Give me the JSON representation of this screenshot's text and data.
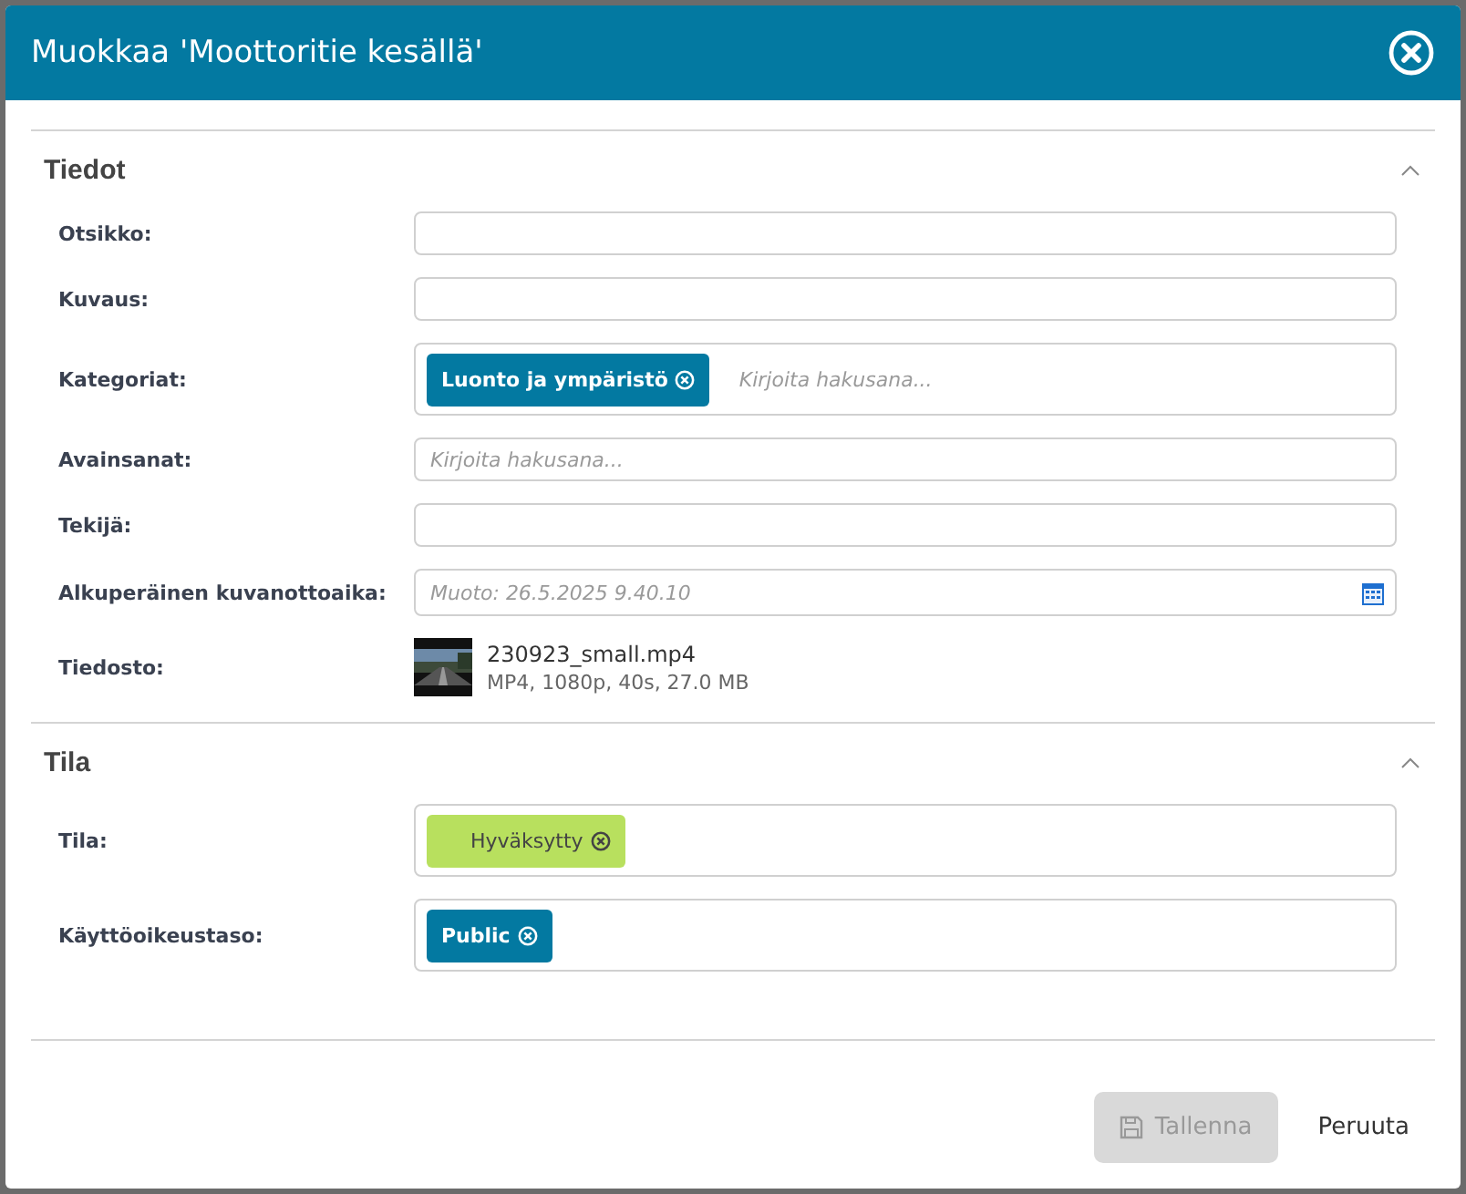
{
  "dialog": {
    "title": "Muokkaa 'Moottoritie kesällä'"
  },
  "sections": [
    {
      "title": "Tiedot",
      "expanded": true,
      "fields": [
        {
          "kind": "text",
          "label": "Otsikko:"
        },
        {
          "kind": "text",
          "label": "Kuvaus:"
        },
        {
          "kind": "tags",
          "label": "Kategoriat:",
          "tags": [
            {
              "label": "Luonto ja ympäristö",
              "color": "#0379a1"
            }
          ],
          "placeholder": "Kirjoita hakusana..."
        },
        {
          "kind": "tags",
          "label": "Avainsanat:",
          "placeholder": "Kirjoita hakusana..."
        },
        {
          "kind": "text",
          "label": "Tekijä:"
        },
        {
          "kind": "date",
          "label": "Alkuperäinen kuvanottoaika:",
          "placeholder": "Muoto: 26.5.2025 9.40.10"
        },
        {
          "kind": "file",
          "label": "Tiedosto:",
          "name": "230923_small.mp4",
          "details": "MP4, 1080p, 40s, 27.0 MB"
        }
      ]
    },
    {
      "title": "Tila",
      "expanded": true,
      "fields": [
        {
          "kind": "tags",
          "label": "Tila:",
          "tags": [
            {
              "label": "Hyväksytty",
              "color": "#b8e05e"
            }
          ]
        },
        {
          "kind": "tags",
          "label": "Käyttöoikeustaso:",
          "tags": [
            {
              "label": "Public",
              "color": "#0379a1"
            }
          ]
        }
      ]
    }
  ],
  "buttons": [
    {
      "label": "Tallenna",
      "kind": "save",
      "disabled": true
    },
    {
      "label": "Peruuta",
      "kind": "cancel",
      "disabled": false
    }
  ]
}
